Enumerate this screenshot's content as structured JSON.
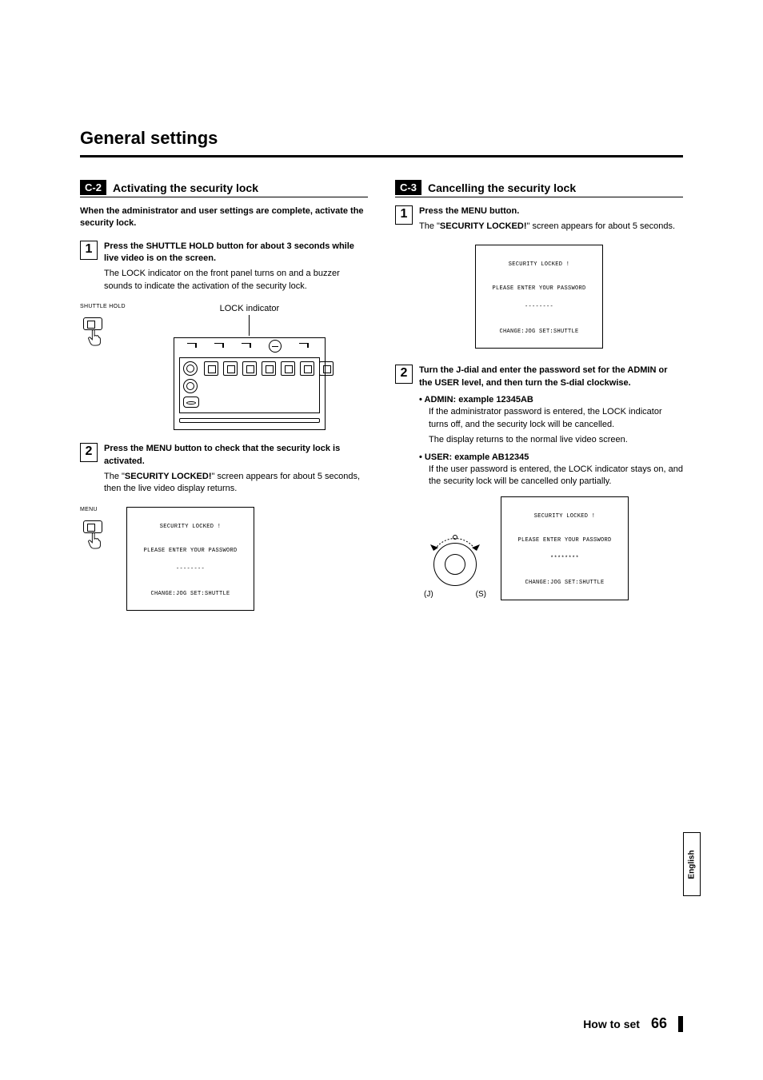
{
  "page": {
    "title": "General settings",
    "footer_label": "How to set",
    "footer_page": "66",
    "side_tab": "English"
  },
  "c2": {
    "badge": "C-2",
    "title": "Activating the security lock",
    "intro": "When the administrator and user settings are complete, activate the security lock.",
    "step1": {
      "num": "1",
      "strong": "Press the SHUTTLE HOLD button for about 3 seconds while live video is on the screen.",
      "desc": "The LOCK indicator on the front panel turns on and a buzzer sounds to indicate the activation of the security lock.",
      "label_shuttle": "SHUTTLE HOLD",
      "label_lock": "LOCK indicator"
    },
    "step2": {
      "num": "2",
      "strong": "Press the MENU button to check that the security lock is activated.",
      "desc_pre": "The \"",
      "desc_bold": "SECURITY LOCKED!",
      "desc_post": "\" screen appears for about 5 seconds, then the live video display returns.",
      "label_menu": "MENU"
    },
    "osd": {
      "line1": "SECURITY LOCKED !",
      "line2": "PLEASE ENTER YOUR PASSWORD",
      "line3": "--------",
      "line4": "CHANGE:JOG   SET:SHUTTLE"
    }
  },
  "c3": {
    "badge": "C-3",
    "title": "Cancelling the security lock",
    "step1": {
      "num": "1",
      "strong": "Press the MENU button.",
      "desc_pre": "The \"",
      "desc_bold": "SECURITY LOCKED!",
      "desc_post": "\" screen appears for about 5 seconds."
    },
    "osd1": {
      "line1": "SECURITY LOCKED !",
      "line2": "PLEASE ENTER YOUR PASSWORD",
      "line3": "--------",
      "line4": "CHANGE:JOG   SET:SHUTTLE"
    },
    "step2": {
      "num": "2",
      "strong": "Turn the J-dial and enter the password set for the ADMIN or the USER level, and then turn the S-dial clockwise.",
      "admin_label": "•  ADMIN: example 12345AB",
      "admin_l1": "If the administrator password is entered, the LOCK indicator turns off, and the security lock will be cancelled.",
      "admin_l2": "The display returns to the normal live video screen.",
      "user_label": "•  USER: example AB12345",
      "user_l1": "If the user password is entered, the LOCK indicator stays on, and the security lock will be cancelled only partially.",
      "j": "(J)",
      "s": "(S)"
    },
    "osd2": {
      "line1": "SECURITY LOCKED !",
      "line2": "PLEASE ENTER YOUR PASSWORD",
      "line3": "********",
      "line4": "CHANGE:JOG   SET:SHUTTLE"
    }
  }
}
